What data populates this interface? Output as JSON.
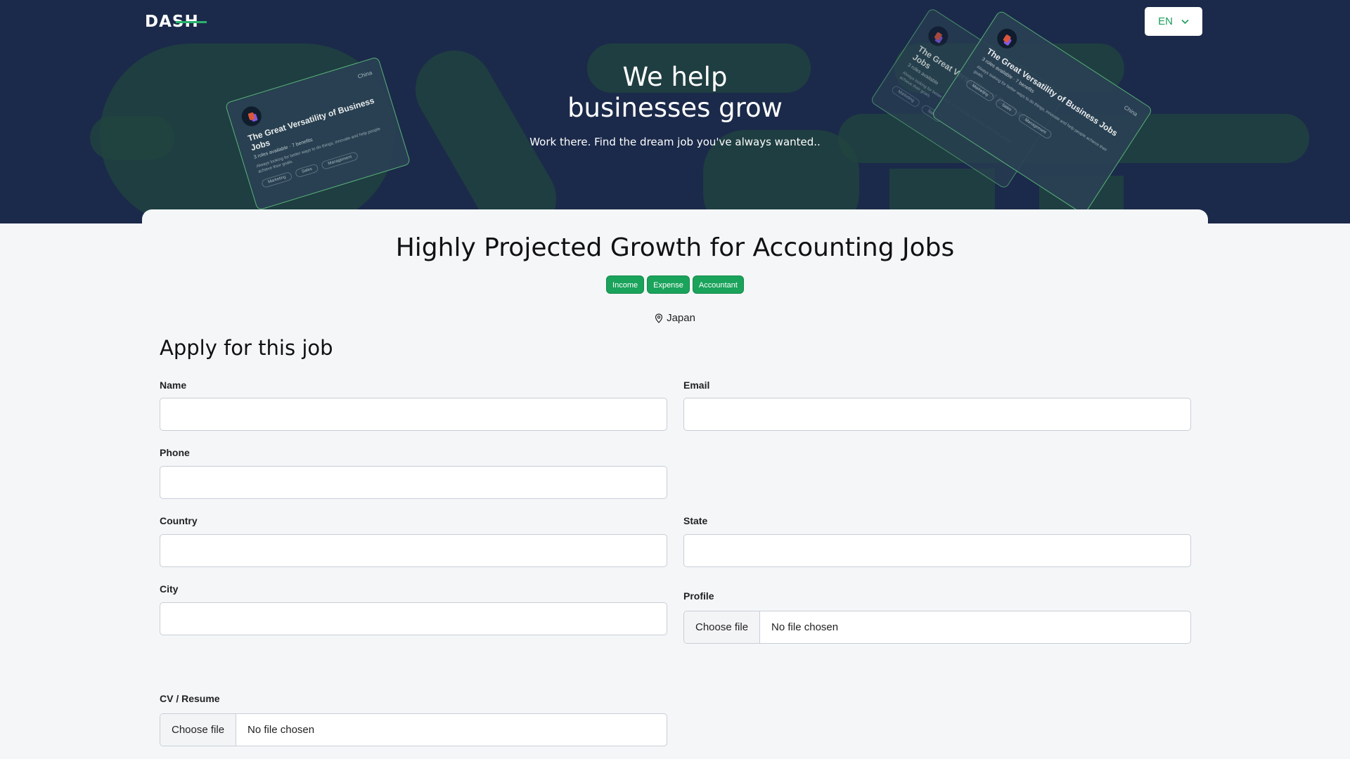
{
  "header": {
    "logo": "DASH",
    "language": "EN"
  },
  "hero": {
    "title_line1": "We help",
    "title_line2": "businesses grow",
    "subtitle": "Work there. Find the dream job you've always wanted.."
  },
  "deco_card": {
    "location": "China",
    "title": "The Great Versatility of Business Jobs",
    "roles": "3 roles available",
    "benefits": "7 benefits",
    "description": "Always looking for better ways to do things, innovate and help people achieve their goals.",
    "tags": [
      "Marketing",
      "Sales",
      "Management"
    ]
  },
  "job": {
    "title": "Highly Projected Growth for Accounting Jobs",
    "tags": [
      "Income",
      "Expense",
      "Accountant"
    ],
    "location": "Japan"
  },
  "form": {
    "heading": "Apply for this job",
    "name_label": "Name",
    "email_label": "Email",
    "phone_label": "Phone",
    "country_label": "Country",
    "state_label": "State",
    "city_label": "City",
    "profile_label": "Profile",
    "cv_label": "CV / Resume",
    "choose_file": "Choose file",
    "no_file": "No file chosen"
  },
  "colors": {
    "hero_bg": "#1b2a4a",
    "accent": "#1aa35b",
    "page_bg": "#f4f6f8"
  }
}
